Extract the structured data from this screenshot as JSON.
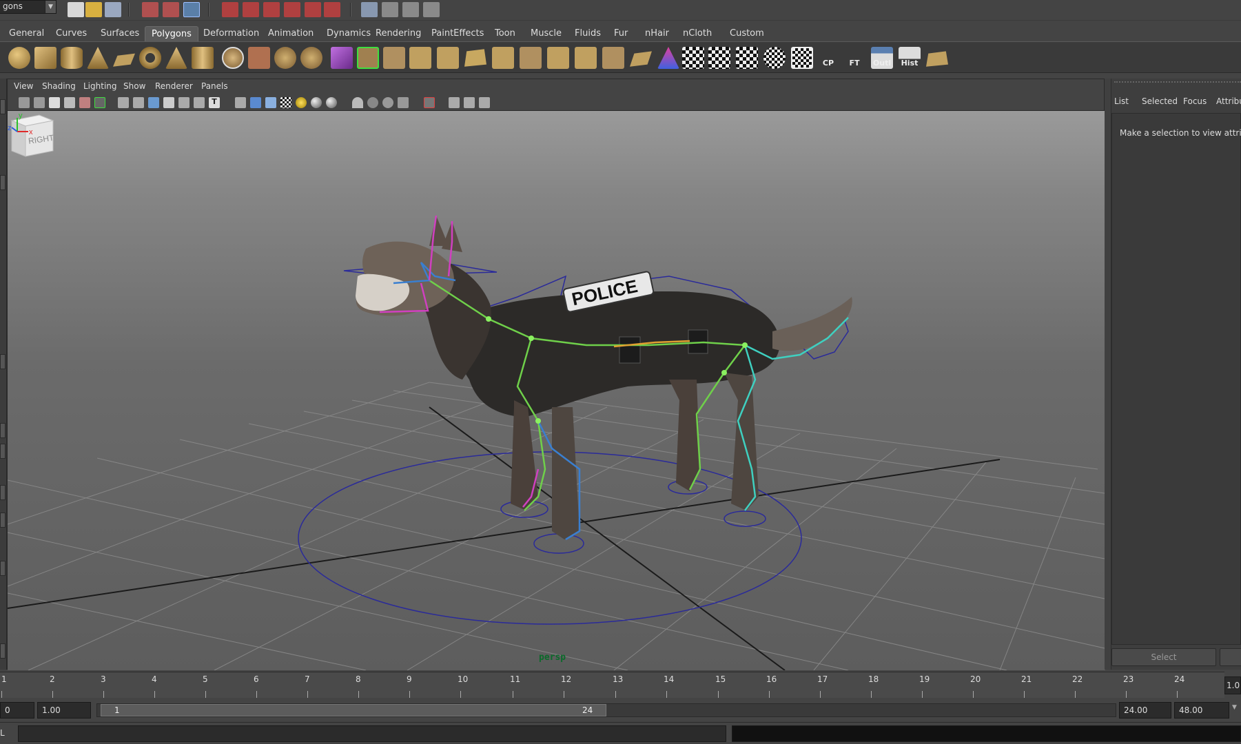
{
  "statusline": {
    "menu_set": "gons"
  },
  "shelf": {
    "tabs": [
      "General",
      "Curves",
      "Surfaces",
      "Polygons",
      "Deformation",
      "Animation",
      "Dynamics",
      "Rendering",
      "PaintEffects",
      "Toon",
      "Muscle",
      "Fluids",
      "Fur",
      "nHair",
      "nCloth",
      "Custom"
    ],
    "active_tab": "Polygons",
    "icon_labels": {
      "cp": "CP",
      "ft": "FT",
      "outl": "Outl",
      "hist": "Hist"
    }
  },
  "viewport": {
    "menus": [
      "View",
      "Shading",
      "Lighting",
      "Show",
      "Renderer",
      "Panels"
    ],
    "camera": "persp",
    "viewcube_face": "RIGHT",
    "badge_text": "POLICE",
    "axis_labels": {
      "x": "x",
      "y": "y",
      "z": "z"
    }
  },
  "attribute_panel": {
    "tabs": [
      "List",
      "Selected",
      "Focus",
      "Attribu"
    ],
    "message": "Make a selection to view attribu",
    "select_button": "Select"
  },
  "timeline": {
    "ticks": [
      "1",
      "2",
      "3",
      "4",
      "5",
      "6",
      "7",
      "8",
      "9",
      "10",
      "11",
      "12",
      "13",
      "14",
      "15",
      "16",
      "17",
      "18",
      "19",
      "20",
      "21",
      "22",
      "23",
      "24"
    ],
    "current_frame": "1.0"
  },
  "range": {
    "left_field": "0",
    "start_time": "1.00",
    "range_start": "1",
    "range_end": "24",
    "end_time": "24.00",
    "playback_end": "48.00"
  },
  "command_line": {
    "label": "L"
  },
  "colors": {
    "skeleton_green": "#6fd04a",
    "skeleton_blue": "#3a7fd0",
    "skeleton_magenta": "#d040c0",
    "control_curve": "#2a2a9a",
    "camera_label": "#0a6a2a"
  }
}
